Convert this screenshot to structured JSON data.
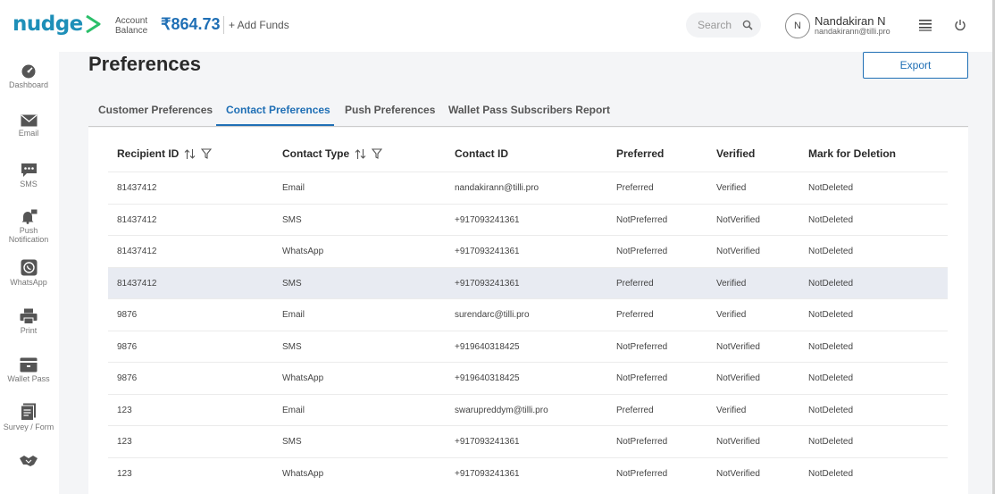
{
  "header": {
    "logo": "nudge",
    "account_label": "Account Balance",
    "balance": "₹864.73",
    "add_funds": "+ Add Funds",
    "search_placeholder": "Search",
    "avatar_initial": "N",
    "user_name": "Nandakiran N",
    "user_email": "nandakirann@tilli.pro"
  },
  "sidebar": {
    "items": [
      {
        "label": "Dashboard",
        "icon": "dashboard-icon"
      },
      {
        "label": "Email",
        "icon": "email-icon"
      },
      {
        "label": "SMS",
        "icon": "sms-icon"
      },
      {
        "label": "Push Notification",
        "icon": "push-notification-icon"
      },
      {
        "label": "WhatsApp",
        "icon": "whatsapp-icon"
      },
      {
        "label": "Print",
        "icon": "print-icon"
      },
      {
        "label": "Wallet Pass",
        "icon": "wallet-pass-icon"
      },
      {
        "label": "Survey / Form",
        "icon": "survey-form-icon"
      },
      {
        "label": "",
        "icon": "handshake-icon"
      }
    ]
  },
  "page": {
    "title": "Preferences",
    "export_label": "Export",
    "tabs": [
      {
        "label": "Customer Preferences",
        "active": false
      },
      {
        "label": "Contact Preferences",
        "active": true
      },
      {
        "label": "Push Preferences",
        "active": false
      },
      {
        "label": "Wallet Pass Subscribers Report",
        "active": false
      }
    ]
  },
  "table": {
    "columns": [
      "Recipient ID",
      "Contact Type",
      "Contact ID",
      "Preferred",
      "Verified",
      "Mark for Deletion"
    ],
    "rows": [
      [
        "81437412",
        "Email",
        "nandakirann@tilli.pro",
        "Preferred",
        "Verified",
        "NotDeleted"
      ],
      [
        "81437412",
        "SMS",
        "+917093241361",
        "NotPreferred",
        "NotVerified",
        "NotDeleted"
      ],
      [
        "81437412",
        "WhatsApp",
        "+917093241361",
        "NotPreferred",
        "NotVerified",
        "NotDeleted"
      ],
      [
        "81437412",
        "SMS",
        "+917093241361",
        "Preferred",
        "Verified",
        "NotDeleted"
      ],
      [
        "9876",
        "Email",
        "surendarc@tilli.pro",
        "Preferred",
        "Verified",
        "NotDeleted"
      ],
      [
        "9876",
        "SMS",
        "+919640318425",
        "NotPreferred",
        "NotVerified",
        "NotDeleted"
      ],
      [
        "9876",
        "WhatsApp",
        "+919640318425",
        "NotPreferred",
        "NotVerified",
        "NotDeleted"
      ],
      [
        "123",
        "Email",
        "swarupreddym@tilli.pro",
        "Preferred",
        "Verified",
        "NotDeleted"
      ],
      [
        "123",
        "SMS",
        "+917093241361",
        "NotPreferred",
        "NotVerified",
        "NotDeleted"
      ],
      [
        "123",
        "WhatsApp",
        "+917093241361",
        "NotPreferred",
        "NotVerified",
        "NotDeleted"
      ]
    ],
    "highlighted_row": 3
  },
  "colors": {
    "brand": "#1e8fb8",
    "accent": "#1f6fb5",
    "highlight_row": "#e8ebf2"
  }
}
